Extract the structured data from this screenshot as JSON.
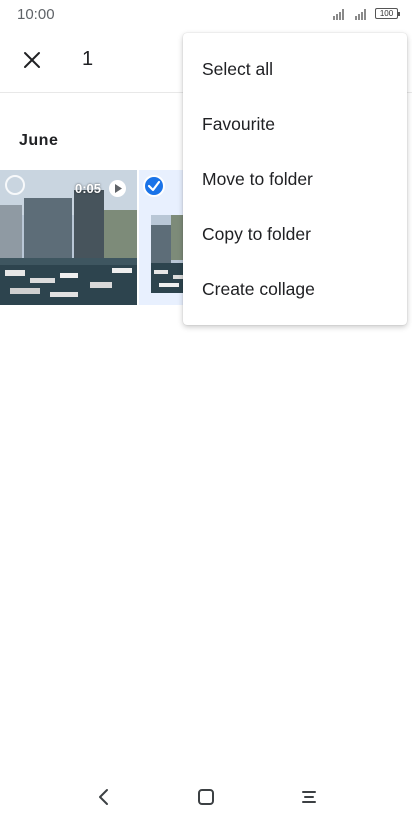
{
  "status_bar": {
    "time": "10:00",
    "battery": "100"
  },
  "app_bar": {
    "selected_count": "1"
  },
  "gallery": {
    "section_title": "June",
    "items": [
      {
        "type": "video",
        "duration": "0:05",
        "selected": false
      },
      {
        "type": "photo",
        "selected": true
      }
    ]
  },
  "menu": {
    "items": [
      {
        "label": "Select all"
      },
      {
        "label": "Favourite"
      },
      {
        "label": "Move to folder"
      },
      {
        "label": "Copy to folder"
      },
      {
        "label": "Create collage"
      }
    ]
  },
  "nav": {
    "icons": [
      "back-icon",
      "home-icon",
      "recents-icon"
    ]
  },
  "colors": {
    "accent": "#1a73e8",
    "text": "#202124",
    "selected_bg": "#e8f0fe"
  }
}
